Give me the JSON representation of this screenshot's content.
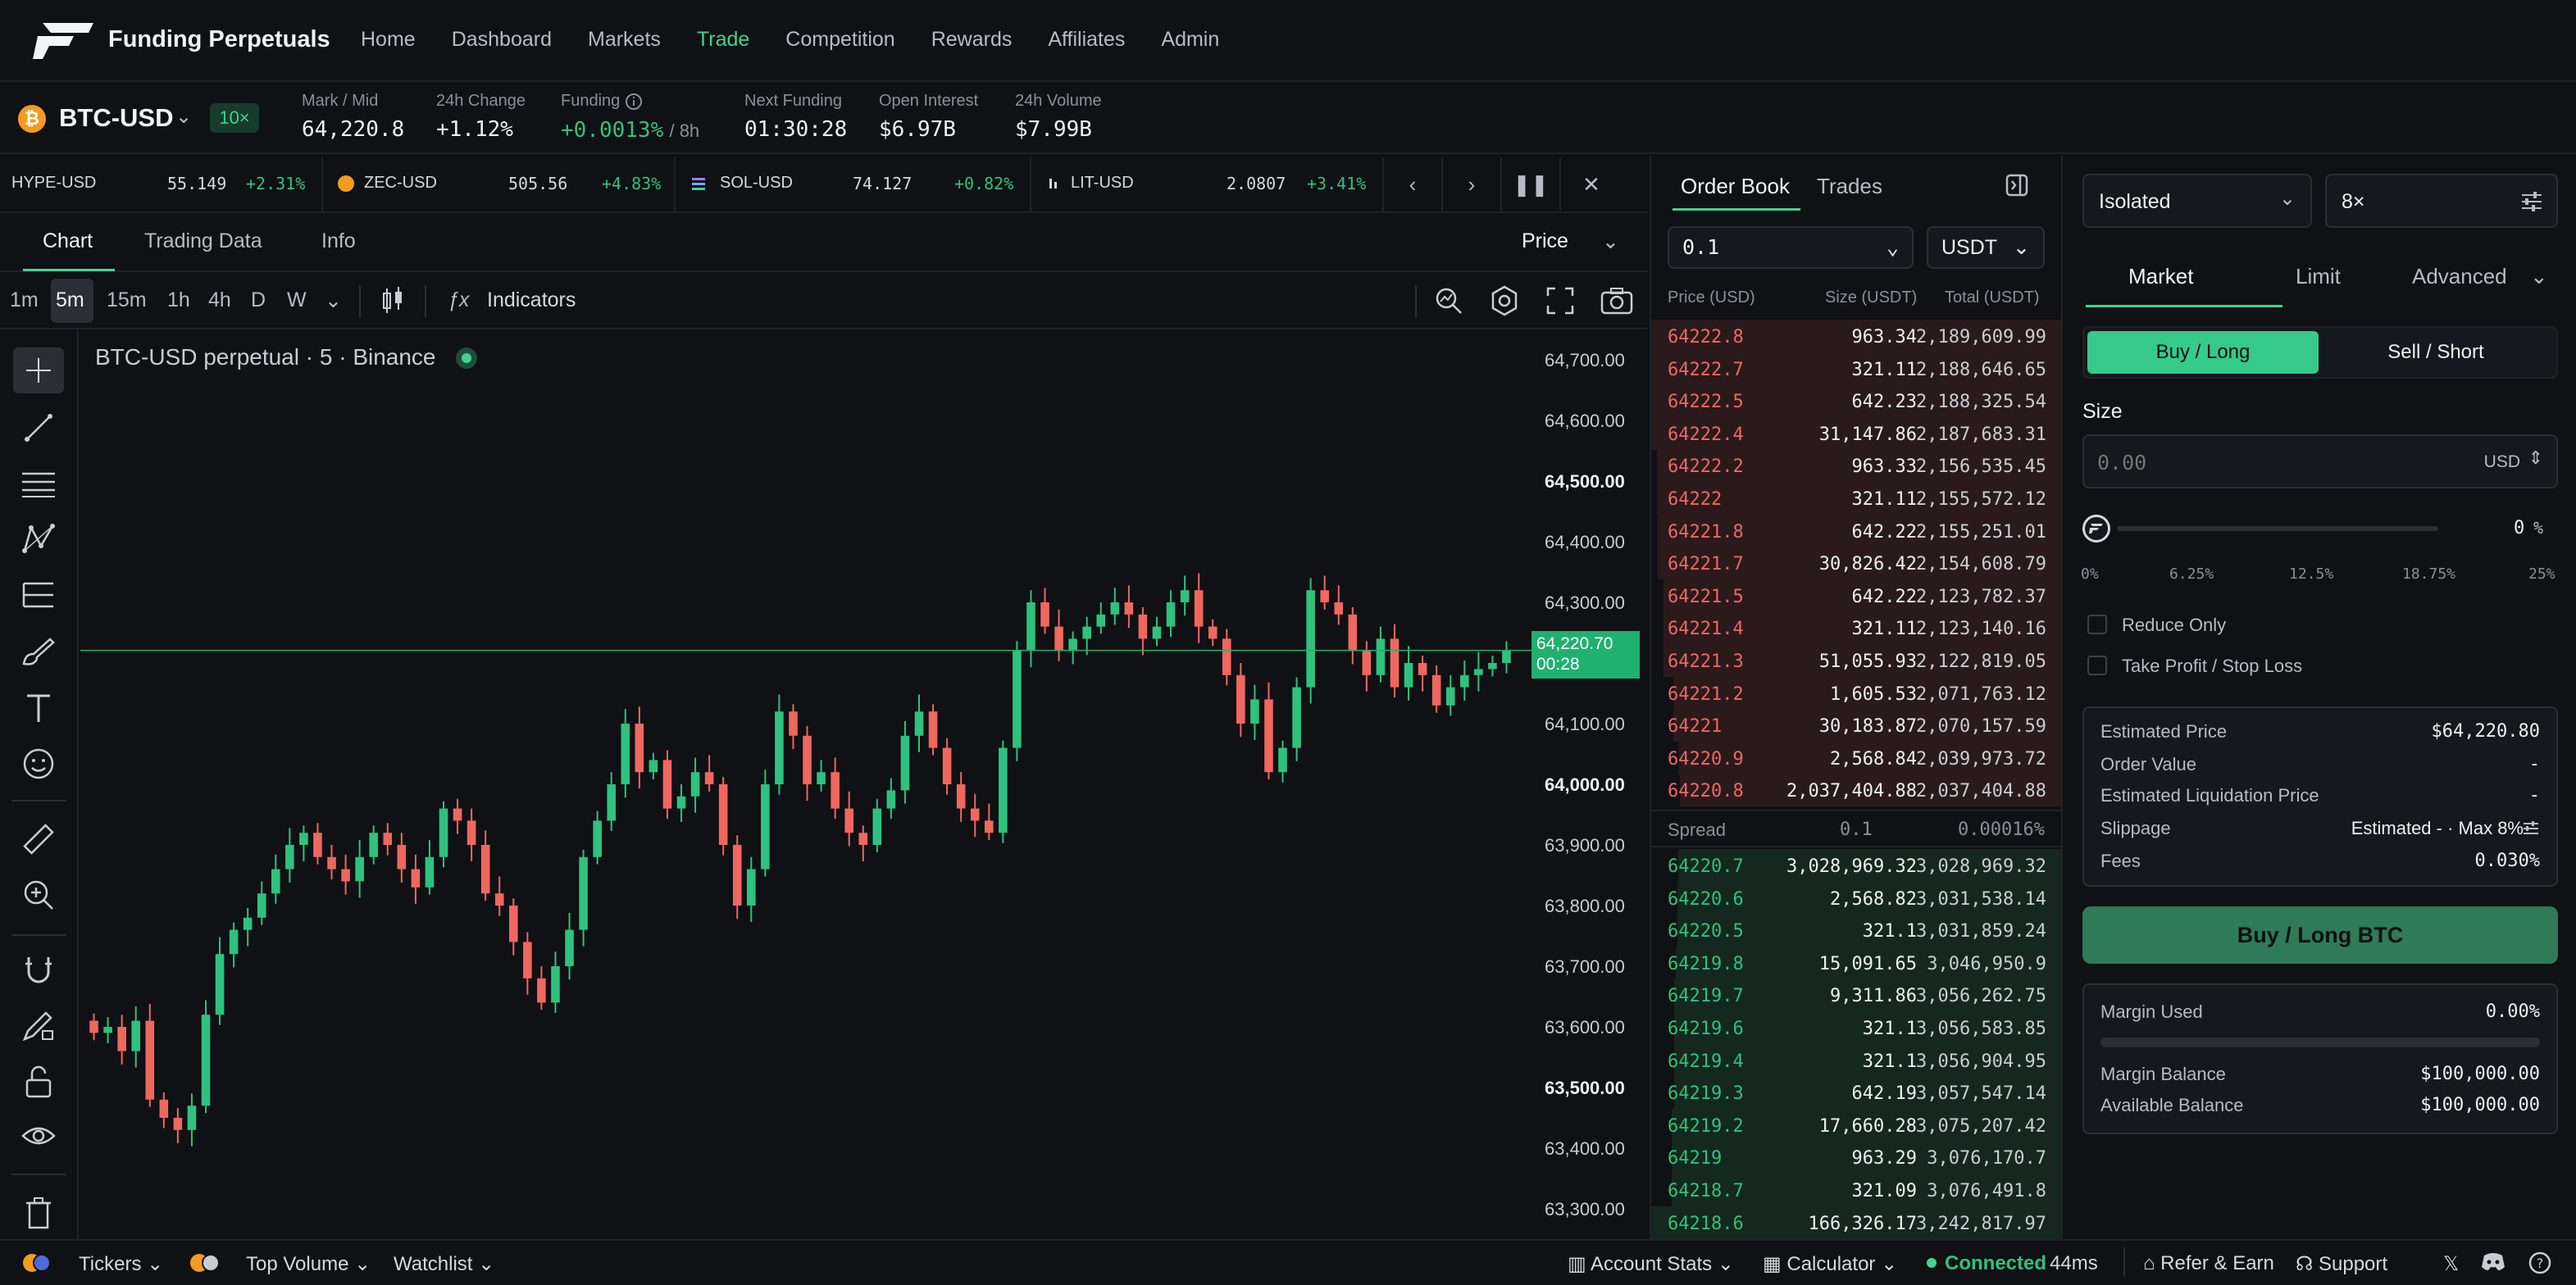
{
  "nav": {
    "brand": "Funding Perpetuals",
    "links": [
      "Home",
      "Dashboard",
      "Markets",
      "Trade",
      "Competition",
      "Rewards",
      "Affiliates",
      "Admin"
    ],
    "active": "Trade"
  },
  "market": {
    "name": "BTC-USD",
    "icon_letter": "₿",
    "leverage_badge": "10×",
    "stats": [
      {
        "label": "Mark / Mid",
        "value": "64,220.8"
      },
      {
        "label": "24h Change",
        "value": "+1.12%"
      },
      {
        "label": "Funding",
        "value": "+0.0013%",
        "suffix": "/ 8h"
      },
      {
        "label": "Next Funding",
        "value": "01:30:28"
      },
      {
        "label": "Open Interest",
        "value": "$6.97B"
      },
      {
        "label": "24h Volume",
        "value": "$7.99B"
      }
    ]
  },
  "ticker_strip": [
    {
      "symbol": "HYPE-USD",
      "price": "55.149",
      "change": "+2.31%"
    },
    {
      "symbol": "ZEC-USD",
      "price": "505.56",
      "change": "+4.83%"
    },
    {
      "symbol": "SOL-USD",
      "price": "74.127",
      "change": "+0.82%"
    },
    {
      "symbol": "LIT-USD",
      "price": "2.0807",
      "change": "+3.41%"
    }
  ],
  "chart_tabs": {
    "tabs": [
      "Chart",
      "Trading Data",
      "Info"
    ],
    "active": "Chart",
    "price_mode": "Price"
  },
  "toolbar": {
    "timeframes": [
      "1m",
      "5m",
      "15m",
      "1h",
      "4h",
      "D",
      "W"
    ],
    "active": "5m",
    "indicators": "Indicators"
  },
  "chart": {
    "title": "BTC-USD perpetual · 5 · Binance",
    "current_price": "64,220.70",
    "countdown": "00:28"
  },
  "chart_data": {
    "type": "candlestick",
    "title": "BTC-USD perpetual · 5 · Binance",
    "y_ticks": [
      "64,700.00",
      "64,600.00",
      "64,500.00",
      "64,400.00",
      "64,300.00",
      "64,200.00",
      "64,100.00",
      "64,000.00",
      "63,900.00",
      "63,800.00",
      "63,700.00",
      "63,600.00",
      "63,500.00",
      "63,400.00",
      "63,300.00"
    ],
    "ylim": [
      63250,
      64750
    ],
    "current": 64220.7,
    "closes": [
      63590,
      63600,
      63560,
      63610,
      63480,
      63450,
      63430,
      63470,
      63620,
      63720,
      63760,
      63780,
      63820,
      63860,
      63900,
      63920,
      63880,
      63860,
      63840,
      63880,
      63920,
      63900,
      63860,
      63830,
      63880,
      63960,
      63940,
      63900,
      63820,
      63800,
      63740,
      63680,
      63640,
      63700,
      63760,
      63880,
      63940,
      64000,
      64100,
      64020,
      64040,
      63960,
      63980,
      64020,
      64000,
      63900,
      63800,
      63860,
      64000,
      64120,
      64080,
      64000,
      64020,
      63960,
      63920,
      63900,
      63960,
      63990,
      64080,
      64120,
      64060,
      64000,
      63960,
      63940,
      63920,
      64060,
      64220,
      64300,
      64260,
      64220,
      64240,
      64260,
      64280,
      64300,
      64280,
      64240,
      64260,
      64300,
      64320,
      64260,
      64240,
      64180,
      64100,
      64140,
      64020,
      64060,
      64160,
      64320,
      64300,
      64280,
      64220,
      64180,
      64240,
      64160,
      64200,
      64180,
      64130,
      64160,
      64180,
      64190,
      64200,
      64220
    ]
  },
  "order_book": {
    "tabs": [
      "Order Book",
      "Trades"
    ],
    "active": "Order Book",
    "tick": "0.1",
    "unit": "USDT",
    "headers": [
      "Price (USD)",
      "Size (USDT)",
      "Total (USDT)"
    ],
    "asks": [
      {
        "price": "64222.8",
        "size": "963.34",
        "total": "2,189,609.99",
        "depth": 1.0
      },
      {
        "price": "64222.7",
        "size": "321.11",
        "total": "2,188,646.65",
        "depth": 1.0
      },
      {
        "price": "64222.5",
        "size": "642.23",
        "total": "2,188,325.54",
        "depth": 1.0
      },
      {
        "price": "64222.4",
        "size": "31,147.86",
        "total": "2,187,683.31",
        "depth": 1.0
      },
      {
        "price": "64222.2",
        "size": "963.33",
        "total": "2,156,535.45",
        "depth": 0.985
      },
      {
        "price": "64222",
        "size": "321.11",
        "total": "2,155,572.12",
        "depth": 0.985
      },
      {
        "price": "64221.8",
        "size": "642.22",
        "total": "2,155,251.01",
        "depth": 0.984
      },
      {
        "price": "64221.7",
        "size": "30,826.42",
        "total": "2,154,608.79",
        "depth": 0.984
      },
      {
        "price": "64221.5",
        "size": "642.22",
        "total": "2,123,782.37",
        "depth": 0.97
      },
      {
        "price": "64221.4",
        "size": "321.11",
        "total": "2,123,140.16",
        "depth": 0.97
      },
      {
        "price": "64221.3",
        "size": "51,055.93",
        "total": "2,122,819.05",
        "depth": 0.969
      },
      {
        "price": "64221.2",
        "size": "1,605.53",
        "total": "2,071,763.12",
        "depth": 0.946
      },
      {
        "price": "64221",
        "size": "30,183.87",
        "total": "2,070,157.59",
        "depth": 0.945
      },
      {
        "price": "64220.9",
        "size": "2,568.84",
        "total": "2,039,973.72",
        "depth": 0.932
      },
      {
        "price": "64220.8",
        "size": "2,037,404.88",
        "total": "2,037,404.88",
        "depth": 0.93
      }
    ],
    "spread": {
      "label": "Spread",
      "value": "0.1",
      "pct": "0.00016%"
    },
    "bids": [
      {
        "price": "64220.7",
        "size": "3,028,969.32",
        "total": "3,028,969.32",
        "depth": 0.934
      },
      {
        "price": "64220.6",
        "size": "2,568.82",
        "total": "3,031,538.14",
        "depth": 0.935
      },
      {
        "price": "64220.5",
        "size": "321.1",
        "total": "3,031,859.24",
        "depth": 0.935
      },
      {
        "price": "64219.8",
        "size": "15,091.65",
        "total": "3,046,950.9",
        "depth": 0.94
      },
      {
        "price": "64219.7",
        "size": "9,311.86",
        "total": "3,056,262.75",
        "depth": 0.943
      },
      {
        "price": "64219.6",
        "size": "321.1",
        "total": "3,056,583.85",
        "depth": 0.943
      },
      {
        "price": "64219.4",
        "size": "321.1",
        "total": "3,056,904.95",
        "depth": 0.943
      },
      {
        "price": "64219.3",
        "size": "642.19",
        "total": "3,057,547.14",
        "depth": 0.943
      },
      {
        "price": "64219.2",
        "size": "17,660.28",
        "total": "3,075,207.42",
        "depth": 0.949
      },
      {
        "price": "64219",
        "size": "963.29",
        "total": "3,076,170.7",
        "depth": 0.949
      },
      {
        "price": "64218.7",
        "size": "321.09",
        "total": "3,076,491.8",
        "depth": 0.949
      },
      {
        "price": "64218.6",
        "size": "166,326.17",
        "total": "3,242,817.97",
        "depth": 1.0
      }
    ]
  },
  "form": {
    "margin_mode": "Isolated",
    "leverage": "8×",
    "order_tabs": [
      "Market",
      "Limit",
      "Advanced"
    ],
    "active_order_tab": "Market",
    "buy_label": "Buy / Long",
    "sell_label": "Sell / Short",
    "size_label": "Size",
    "size_placeholder": "0.00",
    "size_unit": "USD",
    "slider_value": "0",
    "slider_unit": "%",
    "slider_ticks": [
      "0%",
      "6.25%",
      "12.5%",
      "18.75%",
      "25%"
    ],
    "reduce_only": "Reduce Only",
    "tpsl": "Take Profit / Stop Loss",
    "summary": [
      {
        "label": "Estimated Price",
        "value": "$64,220.80"
      },
      {
        "label": "Order Value",
        "value": "-"
      },
      {
        "label": "Estimated Liquidation Price",
        "value": "-"
      },
      {
        "label": "Fees",
        "value": "0.030%"
      }
    ],
    "slippage_label": "Slippage",
    "slippage_value": "Estimated - · Max 8%",
    "submit": "Buy / Long BTC",
    "margin_used_label": "Margin Used",
    "margin_used_value": "0.00%",
    "margin_used_fraction": 0,
    "margin_balance_label": "Margin Balance",
    "margin_balance_value": "$100,000.00",
    "available_balance_label": "Available Balance",
    "available_balance_value": "$100,000.00"
  },
  "footer": {
    "tickers": "Tickers",
    "top_volume": "Top Volume",
    "watchlist": "Watchlist",
    "account_stats": "Account Stats",
    "calculator": "Calculator",
    "connected": "Connected",
    "latency": "44ms",
    "refer": "Refer & Earn",
    "support": "Support"
  },
  "colors": {
    "up": "#2ec27e",
    "down": "#f0675f",
    "accent": "#3ed491"
  }
}
